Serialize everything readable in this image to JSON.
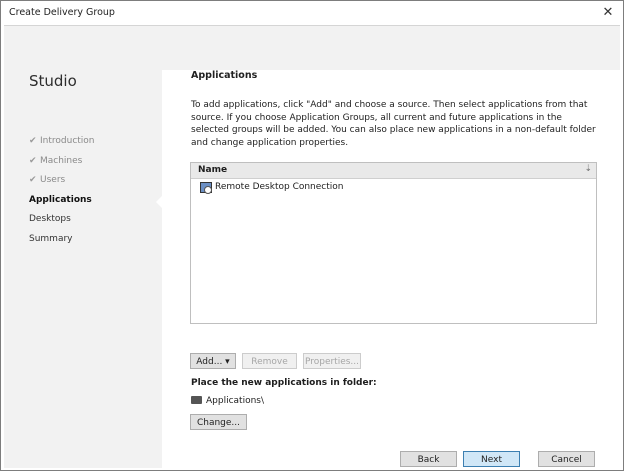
{
  "window": {
    "title": "Create Delivery Group",
    "close_glyph": "✕"
  },
  "sidebar": {
    "title": "Studio",
    "items": [
      {
        "label": "Introduction",
        "state": "completed",
        "check": "✔"
      },
      {
        "label": "Machines",
        "state": "completed",
        "check": "✔"
      },
      {
        "label": "Users",
        "state": "completed",
        "check": "✔"
      },
      {
        "label": "Applications",
        "state": "current",
        "check": ""
      },
      {
        "label": "Desktops",
        "state": "pending",
        "check": ""
      },
      {
        "label": "Summary",
        "state": "pending",
        "check": ""
      }
    ]
  },
  "main": {
    "title": "Applications",
    "description": "To add applications, click \"Add\" and choose a source. Then select applications from that source. If you choose Application Groups, all current and future applications in the selected groups will be added. You can also place new applications in a non-default folder and change application properties.",
    "table": {
      "column_header": "Name",
      "sort_glyph": "⇣",
      "rows": [
        {
          "name": "Remote Desktop Connection",
          "icon": "remote-desktop-icon"
        }
      ]
    },
    "buttons": {
      "add": "Add... ▾",
      "remove": "Remove",
      "properties": "Properties..."
    },
    "folder": {
      "label": "Place the new applications in folder:",
      "value": "Applications\\",
      "icon": "folder-icon",
      "change_button": "Change..."
    }
  },
  "footer": {
    "back": "Back",
    "next": "Next",
    "cancel": "Cancel"
  },
  "colors": {
    "sidebar_bg": "#f2f2f2",
    "primary_border": "#3c7fb1",
    "primary_bg": "#d0e7f7"
  }
}
